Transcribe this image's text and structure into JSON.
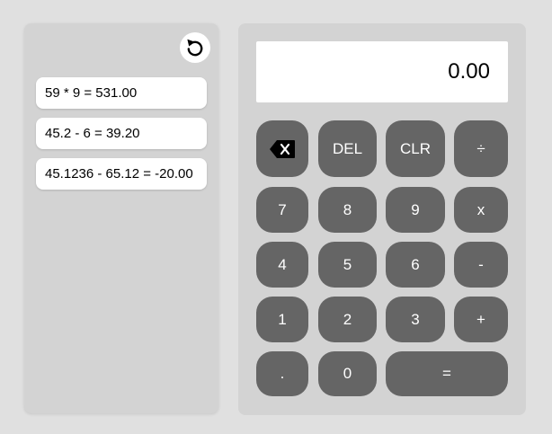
{
  "history": {
    "items": [
      "59 * 9 = 531.00",
      "45.2 - 6 = 39.20",
      "45.1236 - 65.12 = -20.00"
    ]
  },
  "display": {
    "value": "0.00"
  },
  "keys": {
    "backspace_icon": "backspace-icon",
    "del": "DEL",
    "clr": "CLR",
    "divide": "÷",
    "seven": "7",
    "eight": "8",
    "nine": "9",
    "multiply": "x",
    "four": "4",
    "five": "5",
    "six": "6",
    "minus": "-",
    "one": "1",
    "two": "2",
    "three": "3",
    "plus": "+",
    "dot": ".",
    "zero": "0",
    "equals": "="
  },
  "icons": {
    "reset": "reset-icon"
  },
  "colors": {
    "background": "#e0e0e0",
    "panel": "#d3d3d3",
    "key": "#656565",
    "key_text": "#ffffff",
    "display": "#ffffff"
  }
}
